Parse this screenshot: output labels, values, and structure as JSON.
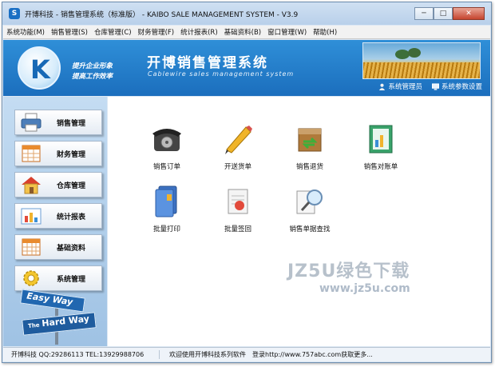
{
  "window": {
    "title": "开博科技 - 销售管理系统（标准版） - KAIBO SALE MANAGEMENT SYSTEM - V3.9",
    "app_icon": "S"
  },
  "menu": [
    "系统功能(M)",
    "销售管理(S)",
    "仓库管理(C)",
    "财务管理(F)",
    "统计报表(R)",
    "基础资料(B)",
    "窗口管理(W)",
    "帮助(H)"
  ],
  "banner": {
    "logo_letter": "K",
    "slogan_line1": "提升企业形象",
    "slogan_line2": "提高工作效率",
    "title": "开博销售管理系统",
    "subtitle": "Cablewire sales management system",
    "user_label": "系统管理员",
    "settings_label": "系统参数设置"
  },
  "sidebar": {
    "items": [
      {
        "label": "销售管理",
        "icon": "printer-icon"
      },
      {
        "label": "财务管理",
        "icon": "calendar-icon"
      },
      {
        "label": "仓库管理",
        "icon": "house-icon"
      },
      {
        "label": "统计报表",
        "icon": "bar-chart-icon"
      },
      {
        "label": "基础资料",
        "icon": "grid-icon"
      },
      {
        "label": "系统管理",
        "icon": "gear-icon"
      }
    ],
    "sign_top": "Easy Way",
    "sign_bottom_small": "The",
    "sign_bottom": "Hard Way"
  },
  "functions": [
    {
      "label": "销售订单",
      "icon": "telephone-icon"
    },
    {
      "label": "开送货单",
      "icon": "pencil-icon"
    },
    {
      "label": "销售退货",
      "icon": "return-box-icon"
    },
    {
      "label": "销售对账单",
      "icon": "ledger-icon"
    },
    {
      "label": "批量打印",
      "icon": "binder-icon"
    },
    {
      "label": "批量签回",
      "icon": "sign-back-icon"
    },
    {
      "label": "销售单据查找",
      "icon": "search-document-icon"
    }
  ],
  "watermark": {
    "line1": "JZ5U绿色下载",
    "line2": "www.jz5u.com"
  },
  "status": {
    "left": "开博科技 QQ:29286113 TEL:13929988706",
    "right": "欢迎使用开博科技系列软件　登录http://www.757abc.com获取更多..."
  }
}
